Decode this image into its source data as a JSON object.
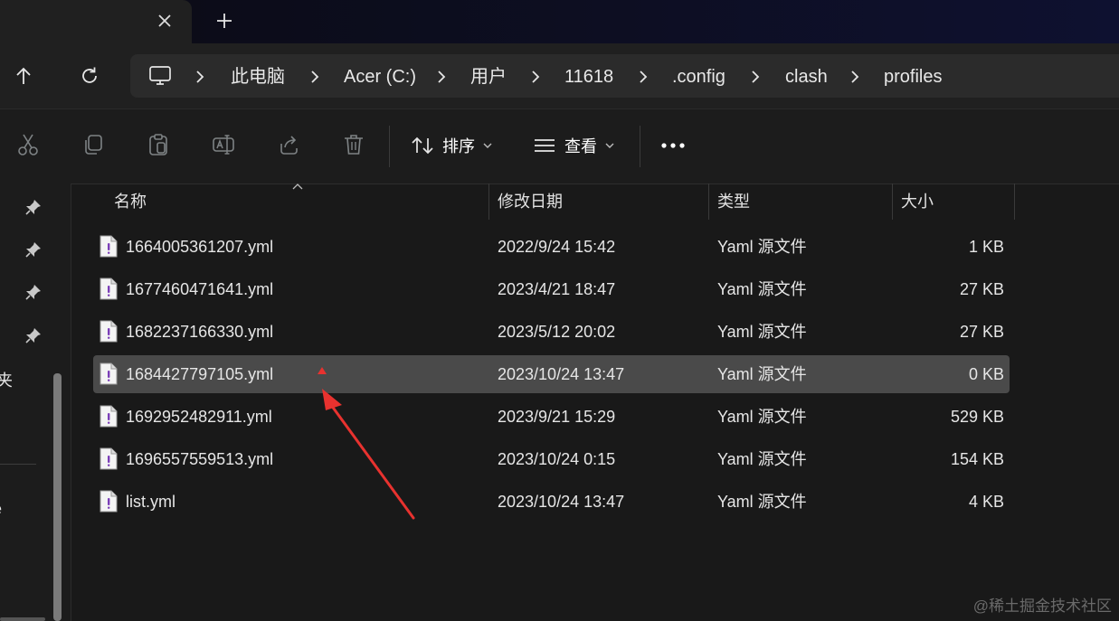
{
  "window": {
    "new_tab_label": "+"
  },
  "breadcrumb": [
    "此电脑",
    "Acer (C:)",
    "用户",
    "11618",
    ".config",
    "clash",
    "profiles"
  ],
  "toolbar": {
    "sort_label": "排序",
    "view_label": "查看",
    "more_label": "•••"
  },
  "icons": {
    "up": "up-arrow-icon",
    "refresh": "refresh-icon",
    "pc": "computer-icon",
    "cut": "scissors-icon",
    "copy": "copy-icon",
    "paste": "clipboard-icon",
    "rename": "rename-icon",
    "share": "share-icon",
    "delete": "trash-icon"
  },
  "leftnav": {
    "frag_1": "夹",
    "frag_2": "e"
  },
  "columns": {
    "name": "名称",
    "modified": "修改日期",
    "type": "类型",
    "size": "大小"
  },
  "files": [
    {
      "name": "1664005361207.yml",
      "modified": "2022/9/24 15:42",
      "type": "Yaml 源文件",
      "size": "1 KB"
    },
    {
      "name": "1677460471641.yml",
      "modified": "2023/4/21 18:47",
      "type": "Yaml 源文件",
      "size": "27 KB"
    },
    {
      "name": "1682237166330.yml",
      "modified": "2023/5/12 20:02",
      "type": "Yaml 源文件",
      "size": "27 KB"
    },
    {
      "name": "1684427797105.yml",
      "modified": "2023/10/24 13:47",
      "type": "Yaml 源文件",
      "size": "0 KB"
    },
    {
      "name": "1692952482911.yml",
      "modified": "2023/9/21 15:29",
      "type": "Yaml 源文件",
      "size": "529 KB"
    },
    {
      "name": "1696557559513.yml",
      "modified": "2023/10/24 0:15",
      "type": "Yaml 源文件",
      "size": "154 KB"
    },
    {
      "name": "list.yml",
      "modified": "2023/10/24 13:47",
      "type": "Yaml 源文件",
      "size": "4 KB"
    }
  ],
  "selected_index": 3,
  "annotation_color": "#e8322f",
  "watermark": "@稀土掘金技术社区"
}
